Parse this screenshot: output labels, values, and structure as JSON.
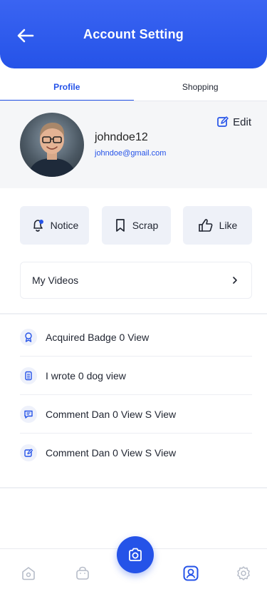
{
  "header": {
    "title": "Account Setting"
  },
  "tabs": [
    {
      "label": "Profile",
      "active": true
    },
    {
      "label": "Shopping",
      "active": false
    }
  ],
  "profile": {
    "username": "johndoe12",
    "email": "johndoe@gmail.com",
    "edit_label": "Edit"
  },
  "actions": [
    {
      "label": "Notice",
      "icon": "bell-icon"
    },
    {
      "label": "Scrap",
      "icon": "bookmark-icon"
    },
    {
      "label": "Like",
      "icon": "thumbs-up-icon"
    }
  ],
  "videos": {
    "label": "My Videos"
  },
  "list": [
    {
      "label": "Acquired Badge 0 View",
      "icon": "badge-icon"
    },
    {
      "label": "I wrote 0 dog view",
      "icon": "document-icon"
    },
    {
      "label": "Comment Dan 0 View S View",
      "icon": "comment-icon"
    },
    {
      "label": "Comment Dan 0 View S View",
      "icon": "edit-icon"
    }
  ],
  "nav": [
    {
      "icon": "home-icon"
    },
    {
      "icon": "bag-icon"
    },
    {
      "icon": "camera-icon"
    },
    {
      "icon": "user-icon",
      "active": true
    },
    {
      "icon": "settings-icon"
    }
  ],
  "colors": {
    "accent": "#2553e8",
    "header": "#3a64f2"
  }
}
